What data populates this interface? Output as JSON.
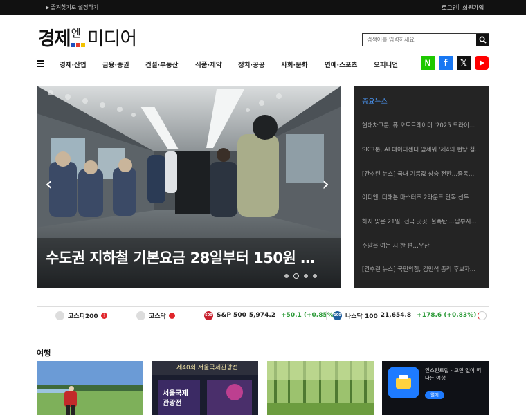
{
  "topbar": {
    "favorite": "즐겨찾기로 설정하기",
    "login": "로그인",
    "join": "회원가입"
  },
  "logo": {
    "part1": "경제",
    "part2": "엔",
    "part3": "미디어"
  },
  "search": {
    "placeholder": "검색어를 입력하세요"
  },
  "nav": {
    "items": [
      "경제·산업",
      "금융·증권",
      "건설·부동산",
      "식품·제약",
      "정치·공공",
      "사회·문화",
      "연예·스포츠",
      "오피니언"
    ]
  },
  "hero": {
    "title": "수도권 지하철 기본요금 28일부터 150원 …",
    "slide_count": 4,
    "active_slide": 2
  },
  "important_news": {
    "heading": "중요뉴스",
    "items": [
      "현대차그룹, 퓨 오토트레이더 '2025 드라이…",
      "SK그룹, AI 데이터센터 앞세워 '제4의 현탕 첨…",
      "[간추린 뉴스] 국내 기름값 상승 전환…중동…",
      "이디엔, 더해븐 마스터즈 2라운드 단독 선두",
      "하지 맞은 21일, 전국 곳곳 '불폭탄'…남부지…",
      "주말을 여는 시 한 편…우산",
      "[간추린 뉴스] 국민의힘, 김민석 총리 후보자…"
    ]
  },
  "ticker": [
    {
      "name": "코스피200",
      "badge": "!"
    },
    {
      "name": "코스닥",
      "badge": "!"
    },
    {
      "name": "S&P 500",
      "value": "5,974.2",
      "change": "+50.1 (+0.85%)",
      "icon": "500"
    },
    {
      "name": "나스닥 100",
      "value": "21,654.8",
      "change": "+178.6 (+0.83%)",
      "icon": "100"
    }
  ],
  "section": {
    "title": "여행"
  },
  "ad": {
    "title": "인스턴트립 - 고민 없이 떠나는 여행",
    "button": "열기"
  },
  "exhibit": {
    "line1": "제40회 서울국제관광전",
    "line2": "서울국제",
    "line3": "관광전"
  },
  "colors": {
    "accent": "#4d9cff",
    "up": "#2e9b3a",
    "badge": "#e0262b"
  }
}
